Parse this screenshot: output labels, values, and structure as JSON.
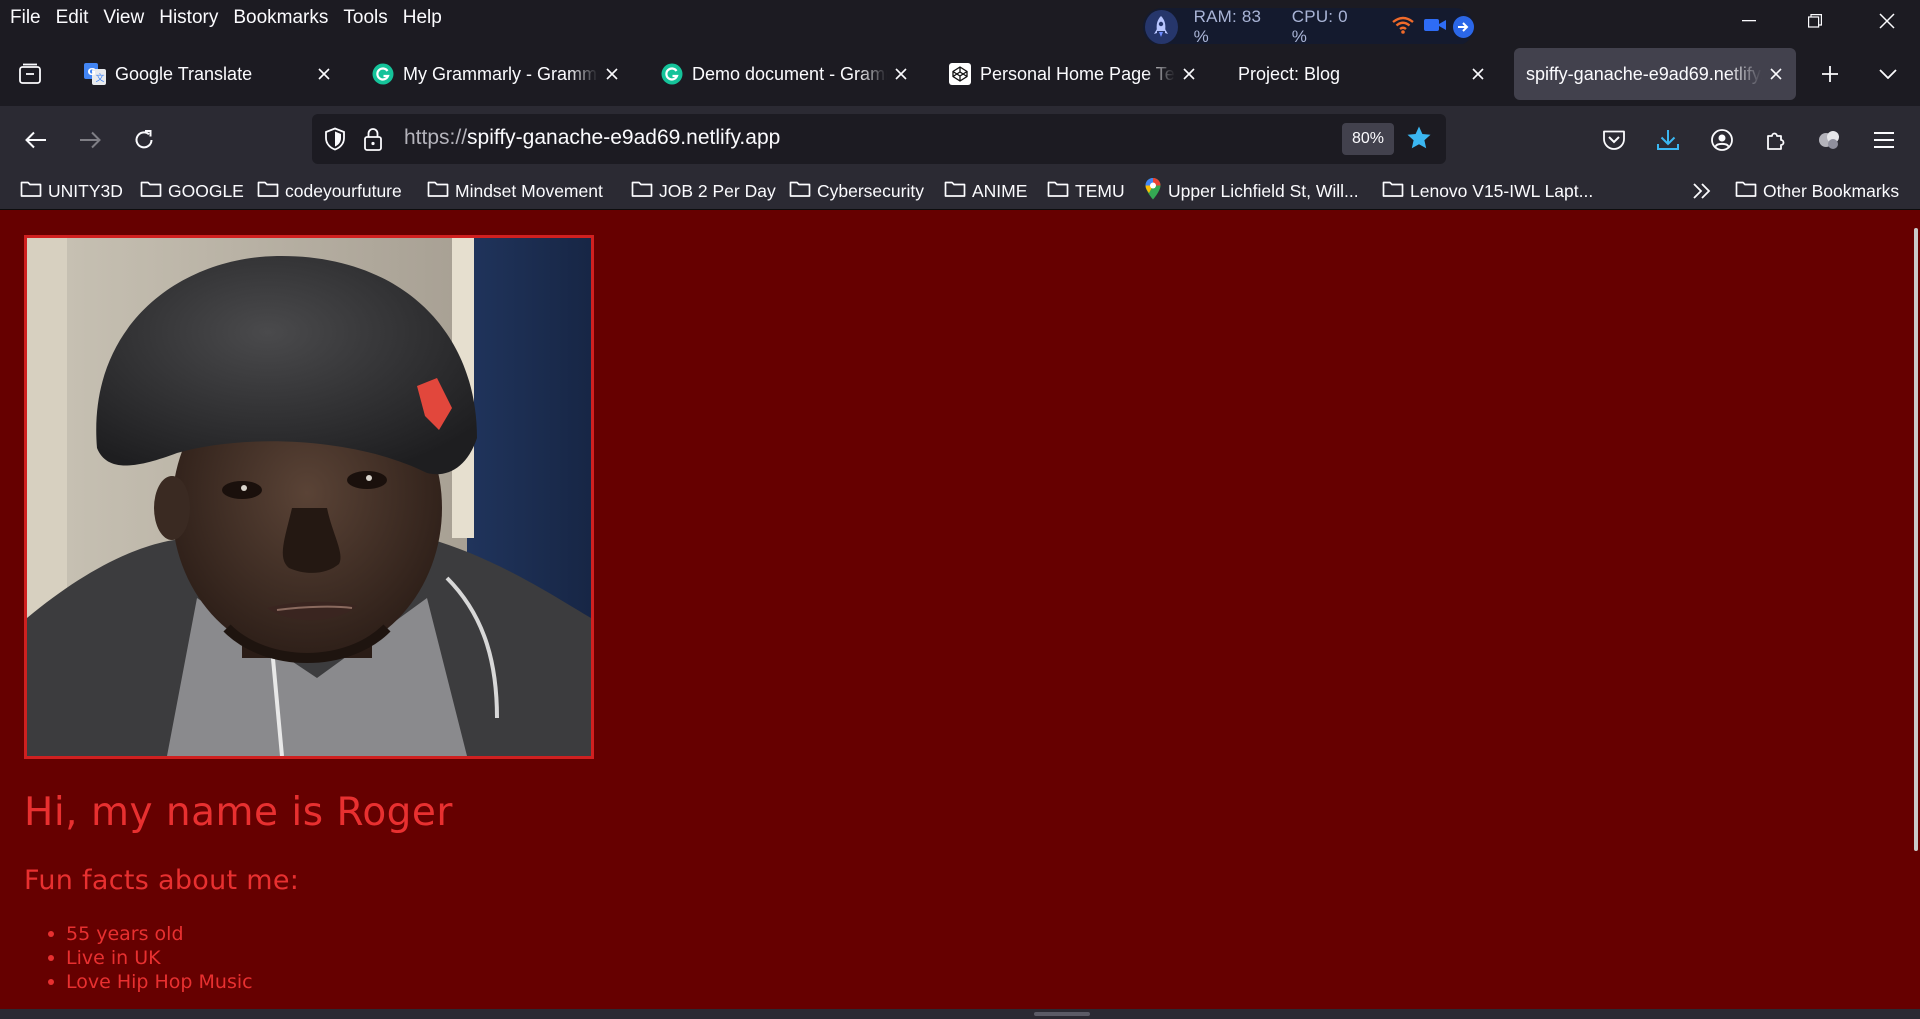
{
  "menubar": {
    "items": [
      "File",
      "Edit",
      "View",
      "History",
      "Bookmarks",
      "Tools",
      "Help"
    ]
  },
  "sysmon": {
    "ram": "RAM: 83 %",
    "cpu": "CPU: 0 %"
  },
  "tabs": [
    {
      "title": "Google Translate",
      "icon": "google-translate-icon"
    },
    {
      "title": "My Grammarly - Grammarly",
      "icon": "grammarly-icon"
    },
    {
      "title": "Demo document - Grammarly",
      "icon": "grammarly-icon"
    },
    {
      "title": "Personal Home Page Template",
      "icon": "codepen-icon"
    },
    {
      "title": "Project: Blog",
      "icon": ""
    },
    {
      "title": "spiffy-ganache-e9ad69.netlify.app",
      "icon": ""
    }
  ],
  "navbar": {
    "url_scheme": "https://",
    "url_host": "spiffy-ganache-e9ad69.netlify.app",
    "zoom": "80%"
  },
  "bookmarks": {
    "items": [
      {
        "label": "UNITY3D",
        "icon": "folder-icon"
      },
      {
        "label": "GOOGLE",
        "icon": "folder-icon"
      },
      {
        "label": "codeyourfuture",
        "icon": "folder-icon"
      },
      {
        "label": "Mindset Movement",
        "icon": "folder-icon"
      },
      {
        "label": "JOB 2 Per Day",
        "icon": "folder-icon"
      },
      {
        "label": "Cybersecurity",
        "icon": "folder-icon"
      },
      {
        "label": "ANIME",
        "icon": "folder-icon"
      },
      {
        "label": "TEMU",
        "icon": "folder-icon"
      },
      {
        "label": "Upper Lichfield St, Will...",
        "icon": "maps-pin-icon"
      },
      {
        "label": "Lenovo V15-IWL Lapt...",
        "icon": "folder-icon"
      }
    ],
    "other": "Other Bookmarks"
  },
  "page": {
    "greeting": "Hi, my name is Roger",
    "facts_title": "Fun facts about me:",
    "facts": [
      "55 years old",
      "Live in UK",
      "Love Hip Hop Music"
    ],
    "background": "#660000",
    "accent": "#e83030"
  }
}
